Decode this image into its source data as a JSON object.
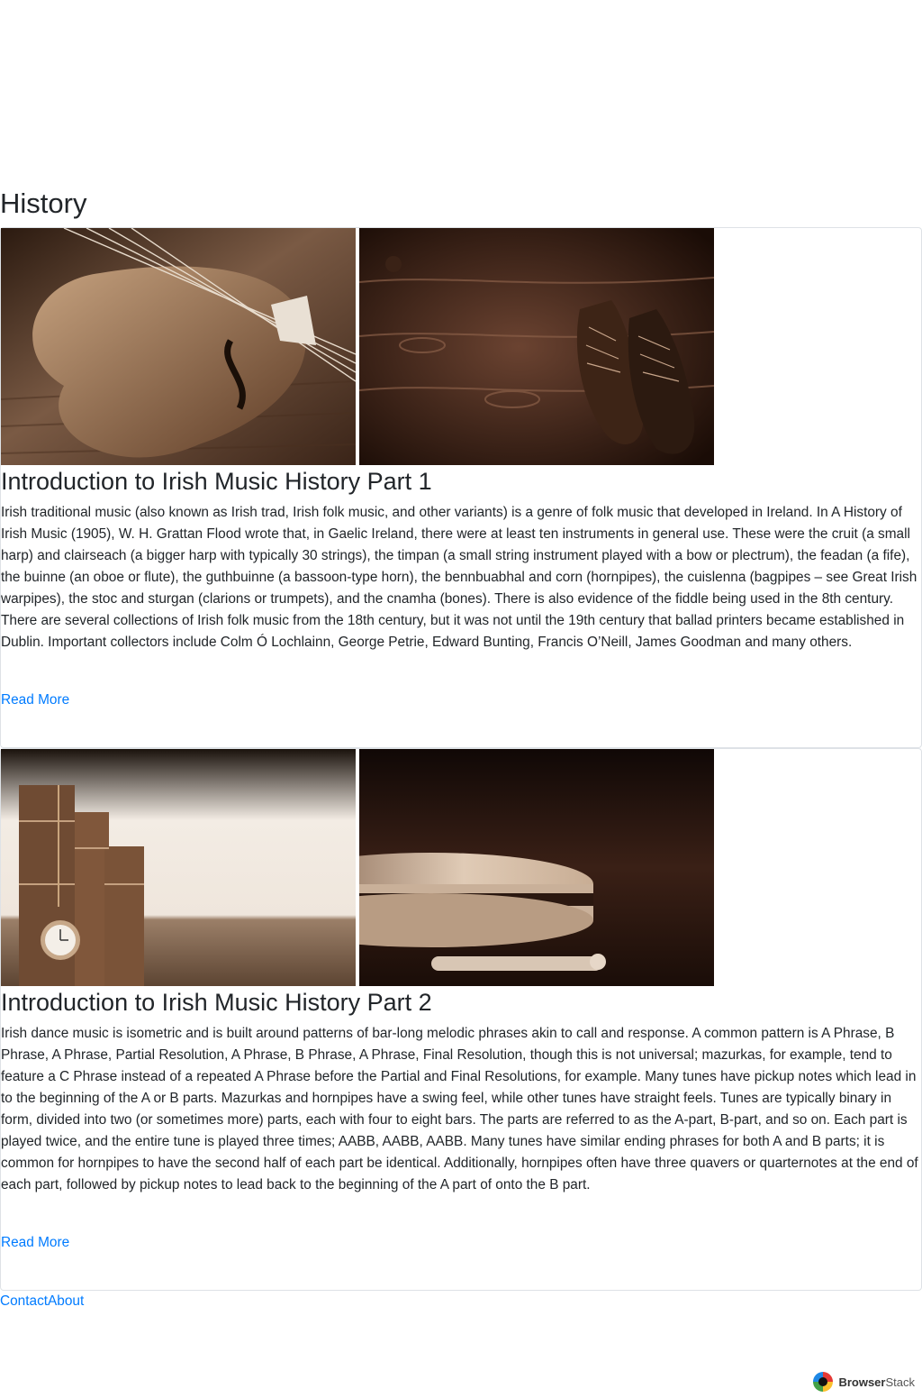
{
  "page": {
    "title": "History"
  },
  "articles": [
    {
      "title": "Introduction to Irish Music History Part 1",
      "images": [
        "violin-image",
        "dance-shoes-image"
      ],
      "text": "Irish traditional music (also known as Irish trad, Irish folk music, and other variants) is a genre of folk music that developed in Ireland. In A History of Irish Music (1905), W. H. Grattan Flood wrote that, in Gaelic Ireland, there were at least ten instruments in general use. These were the cruit (a small harp) and clairseach (a bigger harp with typically 30 strings), the timpan (a small string instrument played with a bow or plectrum), the feadan (a fife), the buinne (an oboe or flute), the guthbuinne (a bassoon-type horn), the bennbuabhal and corn (hornpipes), the cuislenna (bagpipes – see Great Irish warpipes), the stoc and sturgan (clarions or trumpets), and the cnamha (bones). There is also evidence of the fiddle being used in the 8th century. There are several collections of Irish folk music from the 18th century, but it was not until the 19th century that ballad printers became established in Dublin. Important collectors include Colm Ó Lochlainn, George Petrie, Edward Bunting, Francis O’Neill, James Goodman and many others.",
      "read_more": "Read More"
    },
    {
      "title": "Introduction to Irish Music History Part 2",
      "images": [
        "books-pocket-watch-image",
        "bodhran-drum-image"
      ],
      "text": "Irish dance music is isometric and is built around patterns of bar-long melodic phrases akin to call and response. A common pattern is A Phrase, B Phrase, A Phrase, Partial Resolution, A Phrase, B Phrase, A Phrase, Final Resolution, though this is not universal; mazurkas, for example, tend to feature a C Phrase instead of a repeated A Phrase before the Partial and Final Resolutions, for example. Many tunes have pickup notes which lead in to the beginning of the A or B parts. Mazurkas and hornpipes have a swing feel, while other tunes have straight feels. Tunes are typically binary in form, divided into two (or sometimes more) parts, each with four to eight bars. The parts are referred to as the A-part, B-part, and so on. Each part is played twice, and the entire tune is played three times; AABB, AABB, AABB. Many tunes have similar ending phrases for both A and B parts; it is common for hornpipes to have the second half of each part be identical. Additionally, hornpipes often have three quavers or quarternotes at the end of each part, followed by pickup notes to lead back to the beginning of the A part of onto the B part.",
      "read_more": "Read More"
    }
  ],
  "footer": {
    "contact": "Contact",
    "about": "About"
  },
  "badge": {
    "brand_strong": "Browser",
    "brand_light": "Stack"
  },
  "colors": {
    "link": "#007bff",
    "text": "#212529",
    "border": "#dee2e6"
  }
}
